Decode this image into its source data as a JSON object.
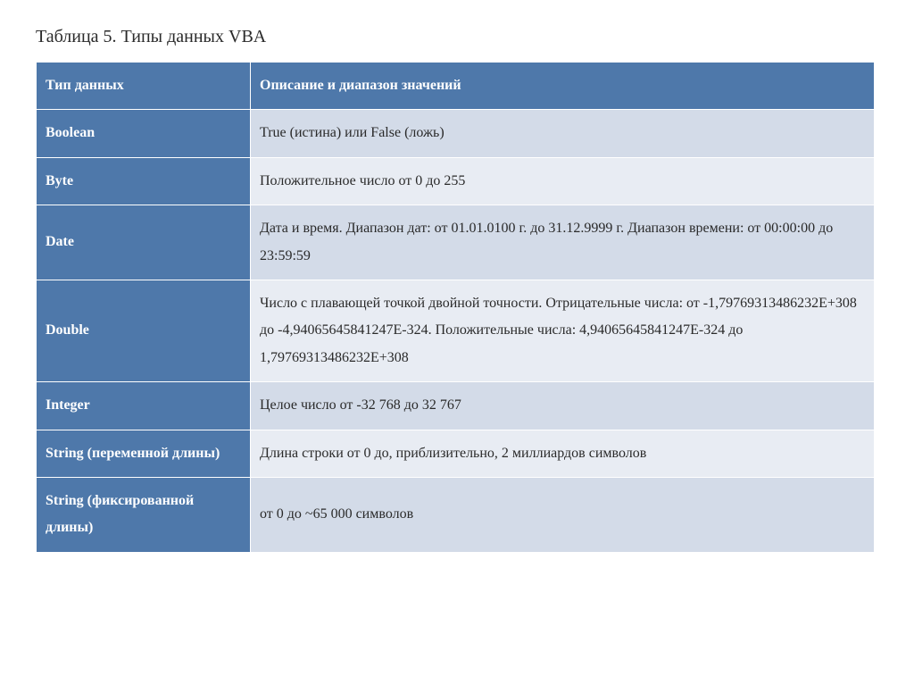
{
  "title": "Таблица 5. Типы данных VBA",
  "headers": {
    "type": "Тип данных",
    "description": "Описание и диапазон значений"
  },
  "rows": [
    {
      "type": "Boolean",
      "description": "True (истина) или False (ложь)"
    },
    {
      "type": "Byte",
      "description": "Положительное число от 0 до 255"
    },
    {
      "type": "Date",
      "description": "Дата и время. Диапазон дат: от 01.01.0100 г. до 31.12.9999 г. Диапазон времени: от 00:00:00 до 23:59:59"
    },
    {
      "type": "Double",
      "description": "Число с плавающей точкой двойной точности. Отрицательные числа: от -1,79769313486232E+308 до -4,94065645841247E-324. Положительные числа: 4,94065645841247E-324 до 1,79769313486232E+308"
    },
    {
      "type": "Integer",
      "description": "Целое число от -32 768 до 32 767"
    },
    {
      "type": "String (переменной длины)",
      "description": "Длина строки от 0 до, приблизительно, 2 миллиардов символов"
    },
    {
      "type": "String (фиксированной длины)",
      "description": "от 0 до ~65 000 символов"
    }
  ]
}
